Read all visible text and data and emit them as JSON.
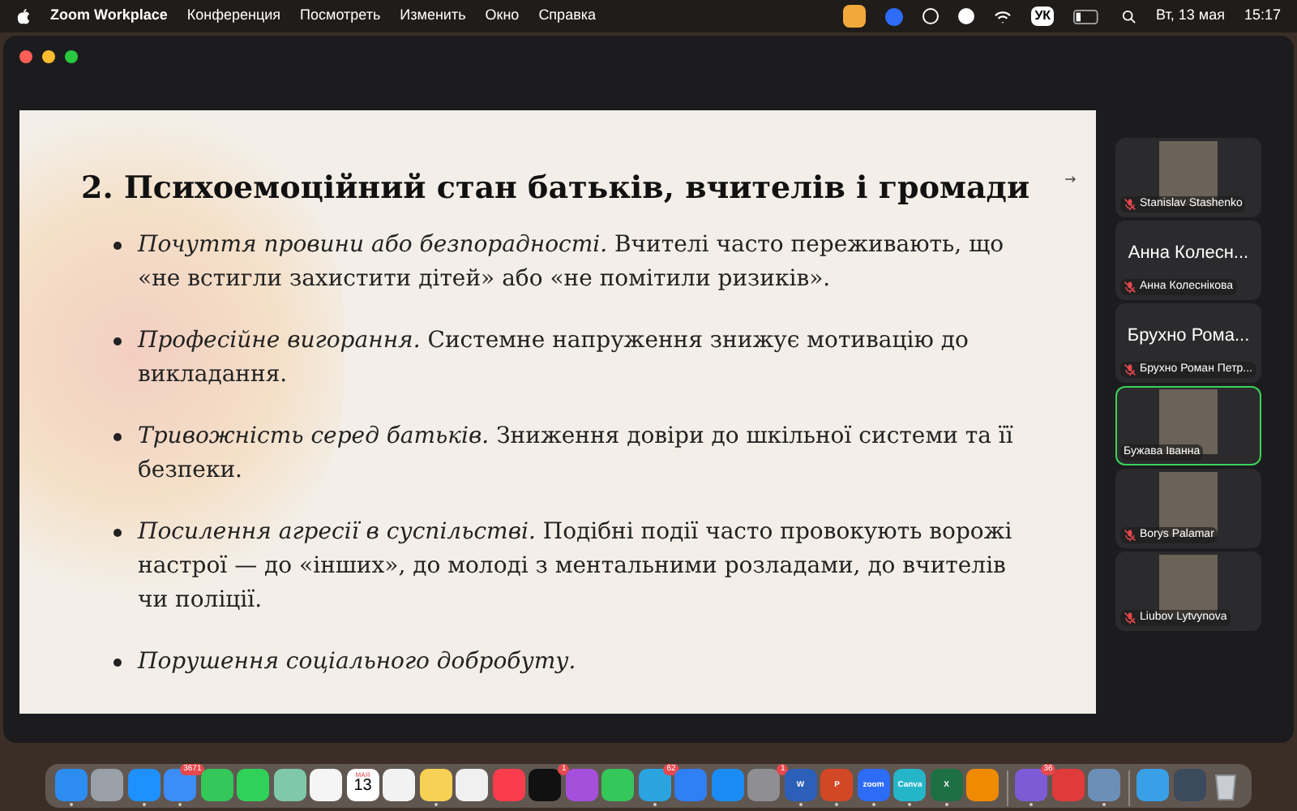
{
  "menu_bar": {
    "app_name": "Zoom Workplace",
    "menus": [
      "Конференция",
      "Посмотреть",
      "Изменить",
      "Окно",
      "Справка"
    ],
    "keyboard_layout": "УК",
    "date": "Вт, 13 мая",
    "time": "15:17"
  },
  "slide": {
    "title": "2. Психоемоційний стан батьків, вчителів і громади",
    "bullets": [
      "*Почуття провини або безпорадності.* Вчителі часто переживають, що «не встигли захистити дітей» або «не помітили ризиків».",
      "*Професійне вигорання.* Системне напруження знижує мотивацію до викладання.",
      "*Тривожність серед батьків.* Зниження довіри до шкільної системи та її безпеки.",
      "*Посилення агресії в суспільстві.* Подібні події часто провокують ворожі настрої — до «інших», до молоді з ментальними розладами, до вчителів чи поліції.",
      "*Порушення соціального добробуту.*"
    ]
  },
  "participants": [
    {
      "kind": "video",
      "name": "Stanislav Stashenko",
      "muted": true,
      "selected": false
    },
    {
      "kind": "name",
      "display": "Анна Колесн...",
      "name": "Анна Колеснікова",
      "muted": true,
      "selected": false
    },
    {
      "kind": "name",
      "display": "Брухно Рома...",
      "name": "Брухно Роман Петр...",
      "muted": true,
      "selected": false
    },
    {
      "kind": "video",
      "name": "Бужава Іванна",
      "muted": false,
      "selected": true
    },
    {
      "kind": "video",
      "name": "Borys Palamar",
      "muted": true,
      "selected": false
    },
    {
      "kind": "video",
      "name": "Liubov Lytvynova",
      "muted": true,
      "selected": false
    }
  ],
  "dock": [
    {
      "kind": "app",
      "color": "#2d8cf0",
      "running": true
    },
    {
      "kind": "app",
      "color": "#9aa0a8",
      "running": false
    },
    {
      "kind": "app",
      "color": "#1e90ff",
      "running": true
    },
    {
      "kind": "app",
      "color": "#3a8ef6",
      "running": true,
      "badge": "3671"
    },
    {
      "kind": "app",
      "color": "#34c759",
      "running": false
    },
    {
      "kind": "app",
      "color": "#30d158",
      "running": false
    },
    {
      "kind": "app",
      "color": "#7fc8a9",
      "running": false
    },
    {
      "kind": "app",
      "color": "#f5f5f5",
      "running": false
    },
    {
      "kind": "calendar",
      "month": "МАЯ",
      "day": "13",
      "running": false
    },
    {
      "kind": "app",
      "color": "#f2f2f2",
      "running": false
    },
    {
      "kind": "app",
      "color": "#f7d154",
      "running": true
    },
    {
      "kind": "app",
      "color": "#f0f0f0",
      "running": false
    },
    {
      "kind": "app",
      "color": "#fa3c4c",
      "running": false
    },
    {
      "kind": "app",
      "color": "#111111",
      "running": false,
      "badge": "1"
    },
    {
      "kind": "app",
      "color": "#a550dc",
      "running": false
    },
    {
      "kind": "app",
      "color": "#34c759",
      "running": false
    },
    {
      "kind": "app",
      "color": "#2aa3e0",
      "running": true,
      "badge": "62"
    },
    {
      "kind": "app",
      "color": "#2f7ff5",
      "running": false
    },
    {
      "kind": "app",
      "color": "#1c8cf5",
      "running": false
    },
    {
      "kind": "app",
      "color": "#8e8e93",
      "running": false,
      "badge": "1"
    },
    {
      "kind": "app",
      "color": "#2b5fb8",
      "running": true,
      "text": "W"
    },
    {
      "kind": "app",
      "color": "#d24726",
      "running": true,
      "text": "P"
    },
    {
      "kind": "app",
      "color": "#2d6cf6",
      "running": true,
      "text": "zoom"
    },
    {
      "kind": "app",
      "color": "#25b5c9",
      "running": true,
      "text": "Canva"
    },
    {
      "kind": "app",
      "color": "#1d7044",
      "running": true,
      "text": "X"
    },
    {
      "kind": "app",
      "color": "#f08a00",
      "running": false
    },
    {
      "kind": "separator"
    },
    {
      "kind": "app",
      "color": "#7b5cd6",
      "running": true,
      "badge": "36"
    },
    {
      "kind": "app",
      "color": "#e03a3a",
      "running": false
    },
    {
      "kind": "app",
      "color": "#6c8fb8",
      "running": true
    },
    {
      "kind": "separator"
    },
    {
      "kind": "app",
      "color": "#39a0e8",
      "running": false
    },
    {
      "kind": "app",
      "color": "#3b4a5c",
      "running": false
    },
    {
      "kind": "trash",
      "running": false
    }
  ]
}
